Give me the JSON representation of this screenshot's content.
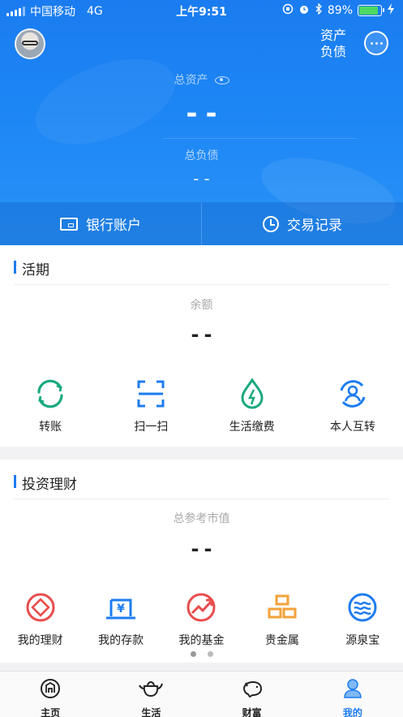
{
  "status_bar": {
    "carrier": "中国移动",
    "network": "4G",
    "time": "上午9:51",
    "battery_percent": "89%",
    "battery_level": 0.89
  },
  "header": {
    "assets_link": "资产\n负债",
    "total_assets_label": "总资产",
    "total_assets_value": "--",
    "total_debt_label": "总负债",
    "total_debt_value": "--",
    "tabs": [
      {
        "label": "银行账户",
        "icon": "bank-card-icon"
      },
      {
        "label": "交易记录",
        "icon": "clock-icon"
      }
    ]
  },
  "current_section": {
    "title": "活期",
    "balance_label": "余额",
    "balance_value": "--",
    "actions": [
      {
        "label": "转账",
        "icon": "transfer-icon"
      },
      {
        "label": "扫一扫",
        "icon": "scan-icon"
      },
      {
        "label": "生活缴费",
        "icon": "utility-payment-icon"
      },
      {
        "label": "本人互转",
        "icon": "self-transfer-icon"
      }
    ]
  },
  "invest_section": {
    "title": "投资理财",
    "market_value_label": "总参考市值",
    "market_value": "--",
    "products": [
      {
        "label": "我的理财",
        "icon": "wealth-icon"
      },
      {
        "label": "我的存款",
        "icon": "deposit-icon"
      },
      {
        "label": "我的基金",
        "icon": "fund-icon"
      },
      {
        "label": "贵金属",
        "icon": "gold-bars-icon"
      },
      {
        "label": "源泉宝",
        "icon": "yuanquanbao-icon"
      }
    ],
    "page_count": 2,
    "current_page": 1
  },
  "bottom_nav": [
    {
      "label": "主页",
      "icon": "home-icon",
      "active": false
    },
    {
      "label": "生活",
      "icon": "teapot-icon",
      "active": false
    },
    {
      "label": "财富",
      "icon": "piggy-bank-icon",
      "active": false
    },
    {
      "label": "我的",
      "icon": "user-icon",
      "active": true
    }
  ],
  "colors": {
    "brand_blue": "#1d7cf0",
    "green": "#1aa97f",
    "red": "#e94d4d",
    "orange": "#f2a23a"
  }
}
